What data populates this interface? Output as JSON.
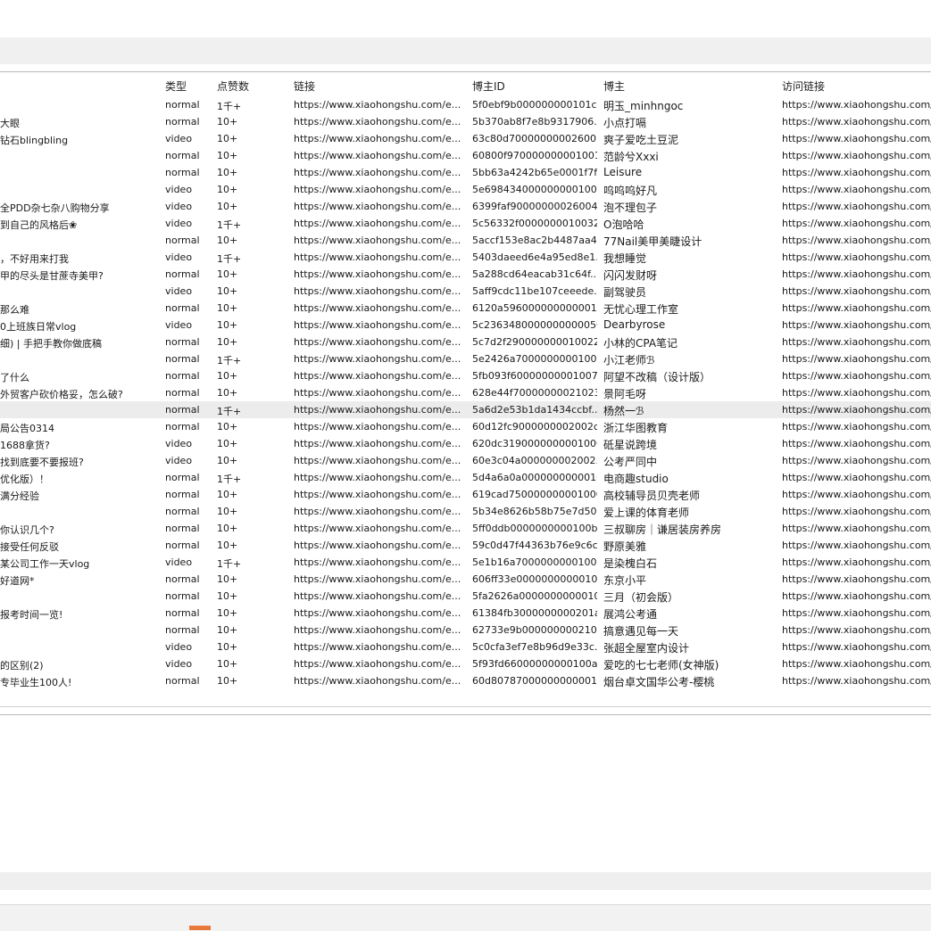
{
  "table": {
    "headers": {
      "type": "类型",
      "likes": "点赞数",
      "link": "链接",
      "blogger_id": "博主ID",
      "blogger": "博主",
      "visit_link": "访问链接"
    },
    "selected_row_index": 18,
    "rows": [
      {
        "title": "",
        "type": "normal",
        "likes": "1千+",
        "link": "https://www.xiaohongshu.com/e...",
        "blogger_id": "5f0ebf9b000000000101c...",
        "blogger": "明玉_minhngoc",
        "visit_link": "https://www.xiaohongshu.com/"
      },
      {
        "title": "大眼",
        "type": "normal",
        "likes": "10+",
        "link": "https://www.xiaohongshu.com/e...",
        "blogger_id": "5b370ab8f7e8b9317906...",
        "blogger": "小点打嗝",
        "visit_link": "https://www.xiaohongshu.com/"
      },
      {
        "title": "钻石blingbling",
        "type": "video",
        "likes": "10+",
        "link": "https://www.xiaohongshu.com/e...",
        "blogger_id": "63c80d70000000002600...",
        "blogger": "爽子爱吃土豆泥",
        "visit_link": "https://www.xiaohongshu.com/"
      },
      {
        "title": "",
        "type": "normal",
        "likes": "10+",
        "link": "https://www.xiaohongshu.com/e...",
        "blogger_id": "60800f970000000001001...",
        "blogger": "范龄兮Xxxi",
        "visit_link": "https://www.xiaohongshu.com/"
      },
      {
        "title": "",
        "type": "normal",
        "likes": "10+",
        "link": "https://www.xiaohongshu.com/e...",
        "blogger_id": "5bb63a4242b65e0001f7f...",
        "blogger": "Leisure",
        "visit_link": "https://www.xiaohongshu.com/"
      },
      {
        "title": "",
        "type": "video",
        "likes": "10+",
        "link": "https://www.xiaohongshu.com/e...",
        "blogger_id": "5e698434000000000100a...",
        "blogger": "呜呜呜好凡",
        "visit_link": "https://www.xiaohongshu.com/"
      },
      {
        "title": "全PDD杂七杂八购物分享",
        "type": "video",
        "likes": "10+",
        "link": "https://www.xiaohongshu.com/e...",
        "blogger_id": "6399faf9000000002600​4...",
        "blogger": "泡不理包子",
        "visit_link": "https://www.xiaohongshu.com/"
      },
      {
        "title": "到自己的风格后❀",
        "type": "video",
        "likes": "1千+",
        "link": "https://www.xiaohongshu.com/e...",
        "blogger_id": "5c56332f0000000010032...",
        "blogger": "O泡哈哈",
        "visit_link": "https://www.xiaohongshu.com/"
      },
      {
        "title": "",
        "type": "normal",
        "likes": "10+",
        "link": "https://www.xiaohongshu.com/e...",
        "blogger_id": "5accf153e8ac2b4487aa4...",
        "blogger": "77Nail美甲美睫设计",
        "visit_link": "https://www.xiaohongshu.com/"
      },
      {
        "title": "，不好用来打我",
        "type": "video",
        "likes": "1千+",
        "link": "https://www.xiaohongshu.com/e...",
        "blogger_id": "5403daeed6e4a95ed8e1...",
        "blogger": "我想睡觉",
        "visit_link": "https://www.xiaohongshu.com/"
      },
      {
        "title": "甲的尽头是甘蔗寺美甲?",
        "type": "normal",
        "likes": "10+",
        "link": "https://www.xiaohongshu.com/e...",
        "blogger_id": "5a288cd64eacab31c64f...",
        "blogger": "闪闪发财呀",
        "visit_link": "https://www.xiaohongshu.com/"
      },
      {
        "title": "",
        "type": "video",
        "likes": "10+",
        "link": "https://www.xiaohongshu.com/e...",
        "blogger_id": "5aff9cdc11be107ceeede...",
        "blogger": "副驾驶员",
        "visit_link": "https://www.xiaohongshu.com/"
      },
      {
        "title": "那么难",
        "type": "normal",
        "likes": "10+",
        "link": "https://www.xiaohongshu.com/e...",
        "blogger_id": "6120a596000000000001001...",
        "blogger": "无忧心理工作室",
        "visit_link": "https://www.xiaohongshu.com/"
      },
      {
        "title": "0上班族日常vlog",
        "type": "video",
        "likes": "10+",
        "link": "https://www.xiaohongshu.com/e...",
        "blogger_id": "5c236348000000000005002...",
        "blogger": "Dearbyrose",
        "visit_link": "https://www.xiaohongshu.com/"
      },
      {
        "title": "细) | 手把手教你做底稿",
        "type": "normal",
        "likes": "10+",
        "link": "https://www.xiaohongshu.com/e...",
        "blogger_id": "5c7d2f290000000010022...",
        "blogger": "小林的CPA笔记",
        "visit_link": "https://www.xiaohongshu.com/"
      },
      {
        "title": "",
        "type": "normal",
        "likes": "1千+",
        "link": "https://www.xiaohongshu.com/e...",
        "blogger_id": "5e2426a70000000001008...",
        "blogger": "小江老师ℬ",
        "visit_link": "https://www.xiaohongshu.com/"
      },
      {
        "title": "了什么",
        "type": "normal",
        "likes": "10+",
        "link": "https://www.xiaohongshu.com/e...",
        "blogger_id": "5fb093f60000000001007...",
        "blogger": "阿望不改稿（设计版）",
        "visit_link": "https://www.xiaohongshu.com/"
      },
      {
        "title": "外贸客户砍价格妥，怎么破?",
        "type": "normal",
        "likes": "10+",
        "link": "https://www.xiaohongshu.com/e...",
        "blogger_id": "628e44f70000000021023...",
        "blogger": "景阿毛呀",
        "visit_link": "https://www.xiaohongshu.com/"
      },
      {
        "title": "",
        "type": "normal",
        "likes": "1千+",
        "link": "https://www.xiaohongshu.com/e...",
        "blogger_id": "5a6d2e53b1da1434ccbf...",
        "blogger": "杨然一ℬ",
        "visit_link": "https://www.xiaohongshu.com/"
      },
      {
        "title": "局公告0314",
        "type": "normal",
        "likes": "10+",
        "link": "https://www.xiaohongshu.com/e...",
        "blogger_id": "60d12fc9000000002002c...",
        "blogger": "浙江华图教育",
        "visit_link": "https://www.xiaohongshu.com/"
      },
      {
        "title": "1688拿货?",
        "type": "video",
        "likes": "10+",
        "link": "https://www.xiaohongshu.com/e...",
        "blogger_id": "620dc3190000000001000f...",
        "blogger": "砥星说跨境",
        "visit_link": "https://www.xiaohongshu.com/"
      },
      {
        "title": "找到底要不要报班?",
        "type": "video",
        "likes": "10+",
        "link": "https://www.xiaohongshu.com/e...",
        "blogger_id": "60e3c04a000000002002...",
        "blogger": "公考严同中",
        "visit_link": "https://www.xiaohongshu.com/"
      },
      {
        "title": "优化版）！",
        "type": "normal",
        "likes": "1千+",
        "link": "https://www.xiaohongshu.com/e...",
        "blogger_id": "5d4a6a0a000000000001002...",
        "blogger": "电商趣studio",
        "visit_link": "https://www.xiaohongshu.com/"
      },
      {
        "title": "满分经验",
        "type": "normal",
        "likes": "10+",
        "link": "https://www.xiaohongshu.com/e...",
        "blogger_id": "619cad750000000001000...",
        "blogger": "高校辅导员贝壳老师",
        "visit_link": "https://www.xiaohongshu.com/"
      },
      {
        "title": "",
        "type": "normal",
        "likes": "10+",
        "link": "https://www.xiaohongshu.com/e...",
        "blogger_id": "5b34e8626b58b75e7d50...",
        "blogger": "爱上课的体育老师",
        "visit_link": "https://www.xiaohongshu.com/"
      },
      {
        "title": "你认识几个?",
        "type": "normal",
        "likes": "10+",
        "link": "https://www.xiaohongshu.com/e...",
        "blogger_id": "5ff0ddb0000000000100b...",
        "blogger": "三叔聊房｜谦居装房养房",
        "visit_link": "https://www.xiaohongshu.com/"
      },
      {
        "title": "接受任何反驳",
        "type": "normal",
        "likes": "10+",
        "link": "https://www.xiaohongshu.com/e...",
        "blogger_id": "59c0d47f44363b76e9c6c...",
        "blogger": "野原美雅",
        "visit_link": "https://www.xiaohongshu.com/"
      },
      {
        "title": "某公司工作一天vlog",
        "type": "video",
        "likes": "1千+",
        "link": "https://www.xiaohongshu.com/e...",
        "blogger_id": "5e1b16a7000000000100...",
        "blogger": "是染槐白石",
        "visit_link": "https://www.xiaohongshu.com/"
      },
      {
        "title": "好道网*",
        "type": "normal",
        "likes": "10+",
        "link": "https://www.xiaohongshu.com/e...",
        "blogger_id": "606ff33e000000000001006...",
        "blogger": "东京小平",
        "visit_link": "https://www.xiaohongshu.com/"
      },
      {
        "title": "",
        "type": "normal",
        "likes": "10+",
        "link": "https://www.xiaohongshu.com/e...",
        "blogger_id": "5fa2626a000000000001005...",
        "blogger": "三月（初会版）",
        "visit_link": "https://www.xiaohongshu.com/"
      },
      {
        "title": "报考时间一览!",
        "type": "normal",
        "likes": "10+",
        "link": "https://www.xiaohongshu.com/e...",
        "blogger_id": "61384fb3000000000201a...",
        "blogger": "展鸿公考通",
        "visit_link": "https://www.xiaohongshu.com/"
      },
      {
        "title": "",
        "type": "normal",
        "likes": "10+",
        "link": "https://www.xiaohongshu.com/e...",
        "blogger_id": "62733e9b0000000002102...",
        "blogger": "搞意遇见每一天",
        "visit_link": "https://www.xiaohongshu.com/"
      },
      {
        "title": "",
        "type": "video",
        "likes": "10+",
        "link": "https://www.xiaohongshu.com/e...",
        "blogger_id": "5c0cfa3ef7e8b96d9e33c...",
        "blogger": "张超全屋室内设计",
        "visit_link": "https://www.xiaohongshu.com/"
      },
      {
        "title": "的区别(2)",
        "type": "video",
        "likes": "10+",
        "link": "https://www.xiaohongshu.com/e...",
        "blogger_id": "5f93fd66000000000100a...",
        "blogger": "爱吃的七七老师(女神版)",
        "visit_link": "https://www.xiaohongshu.com/"
      },
      {
        "title": "专毕业生100人!",
        "type": "normal",
        "likes": "10+",
        "link": "https://www.xiaohongshu.com/e...",
        "blogger_id": "60d8078700000000000100...",
        "blogger": "烟台卓文国华公考-樱桃",
        "visit_link": "https://www.xiaohongshu.com/"
      }
    ]
  },
  "colors": {
    "selected_row": "#ececec",
    "toolbar": "#f0f0f0",
    "taskbar_accent": "#e8793a"
  }
}
